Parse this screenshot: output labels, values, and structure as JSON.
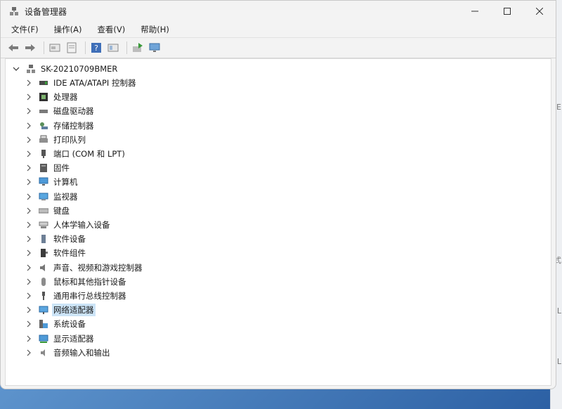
{
  "window": {
    "title": "设备管理器"
  },
  "menu": [
    "文件(F)",
    "操作(A)",
    "查看(V)",
    "帮助(H)"
  ],
  "toolbar": [
    "back-arrow-icon",
    "forward-arrow-icon",
    "properties-icon",
    "driver-icon",
    "help-icon",
    "view-icon",
    "update-driver-icon",
    "monitor-scan-icon"
  ],
  "tree": {
    "root": "SK-20210709BMER",
    "items": [
      {
        "label": "IDE ATA/ATAPI 控制器",
        "icon": "ide-controller-icon"
      },
      {
        "label": "处理器",
        "icon": "processor-icon"
      },
      {
        "label": "磁盘驱动器",
        "icon": "disk-drive-icon"
      },
      {
        "label": "存储控制器",
        "icon": "storage-controller-icon"
      },
      {
        "label": "打印队列",
        "icon": "printer-icon"
      },
      {
        "label": "端口 (COM 和 LPT)",
        "icon": "port-icon"
      },
      {
        "label": "固件",
        "icon": "firmware-icon"
      },
      {
        "label": "计算机",
        "icon": "computer-icon"
      },
      {
        "label": "监视器",
        "icon": "monitor-icon"
      },
      {
        "label": "键盘",
        "icon": "keyboard-icon"
      },
      {
        "label": "人体学输入设备",
        "icon": "hid-icon"
      },
      {
        "label": "软件设备",
        "icon": "software-device-icon"
      },
      {
        "label": "软件组件",
        "icon": "software-component-icon"
      },
      {
        "label": "声音、视频和游戏控制器",
        "icon": "speaker-icon"
      },
      {
        "label": "鼠标和其他指针设备",
        "icon": "mouse-icon"
      },
      {
        "label": "通用串行总线控制器",
        "icon": "usb-icon"
      },
      {
        "label": "网络适配器",
        "icon": "network-adapter-icon",
        "selected": true
      },
      {
        "label": "系统设备",
        "icon": "system-device-icon"
      },
      {
        "label": "显示适配器",
        "icon": "display-adapter-icon"
      },
      {
        "label": "音频输入和输出",
        "icon": "audio-io-icon"
      }
    ]
  },
  "side_chars": [
    "'E",
    "式",
    "L",
    "L"
  ]
}
